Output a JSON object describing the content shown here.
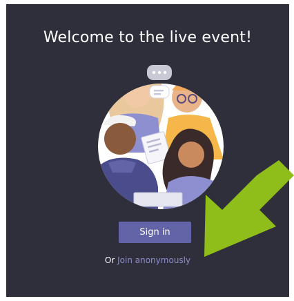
{
  "welcome": {
    "title": "Welcome to the live event!"
  },
  "actions": {
    "sign_in_label": "Sign in",
    "or_text": "Or",
    "join_anonymously_label": "Join anonymously"
  },
  "colors": {
    "background": "#2f2f3c",
    "primary_button": "#6264a7",
    "link": "#8b8cc7",
    "annotation_arrow": "#8fbe1b"
  },
  "icons": {
    "illustration": "people-chatting-illustration",
    "arrow": "annotation-arrow"
  }
}
